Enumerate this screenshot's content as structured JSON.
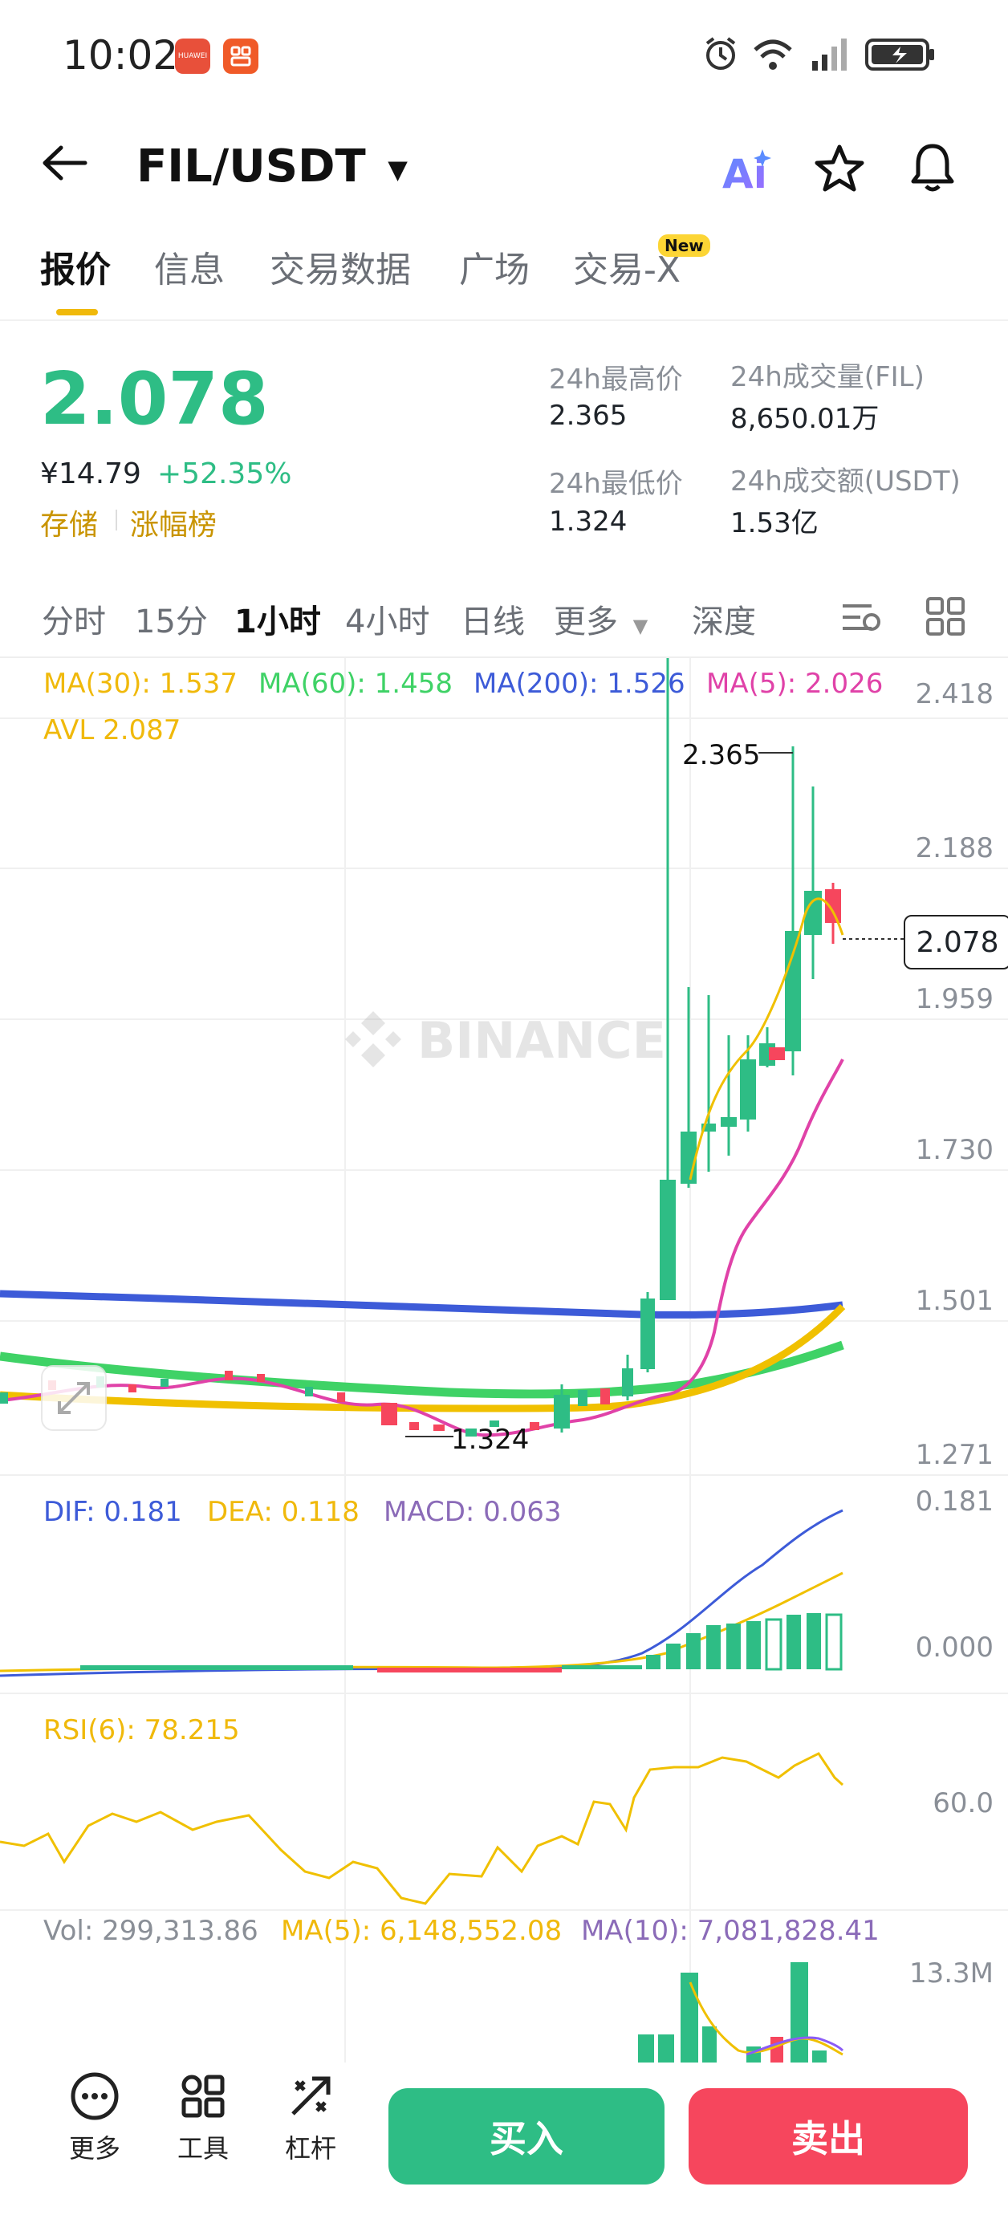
{
  "status_bar": {
    "time": "10:02",
    "app_badge_1": "HUAWEI"
  },
  "header": {
    "pair": "FIL/USDT",
    "ai_label": "Ai"
  },
  "tabs": [
    {
      "label": "报价",
      "active": true
    },
    {
      "label": "信息"
    },
    {
      "label": "交易数据"
    },
    {
      "label": "广场"
    },
    {
      "label": "交易-X",
      "badge": "New"
    }
  ],
  "ticker": {
    "last_price": "2.078",
    "cny_price": "¥14.79",
    "change_pct": "+52.35%",
    "tag_1": "存储",
    "tag_2": "涨幅榜",
    "high_label": "24h最高价",
    "high_value": "2.365",
    "low_label": "24h最低价",
    "low_value": "1.324",
    "vol_base_label": "24h成交量(FIL)",
    "vol_base_value": "8,650.01万",
    "vol_quote_label": "24h成交额(USDT)",
    "vol_quote_value": "1.53亿"
  },
  "intervals": [
    "分时",
    "15分",
    "1小时",
    "4小时",
    "日线",
    "更多",
    "深度"
  ],
  "active_interval": "1小时",
  "indicators": {
    "ma30": "MA(30): 1.537",
    "ma60": "MA(60): 1.458",
    "ma200": "MA(200): 1.526",
    "ma5": "MA(5): 2.026",
    "avl": "AVL 2.087",
    "dif": "DIF: 0.181",
    "dea": "DEA: 0.118",
    "macd": "MACD: 0.063",
    "rsi": "RSI(6): 78.215",
    "vol": "Vol: 299,313.86",
    "vol_ma5": "MA(5): 6,148,552.08",
    "vol_ma10": "MA(10): 7,081,828.41"
  },
  "price_axis": [
    "2.418",
    "2.188",
    "1.959",
    "1.730",
    "1.501",
    "1.271"
  ],
  "current_price_tag": "2.078",
  "high_marker": "2.365",
  "low_marker": "1.324",
  "watermark": "BINANCE",
  "macd_axis": [
    "0.181",
    "0.000"
  ],
  "rsi_axis": [
    "60.0"
  ],
  "vol_axis": [
    "13.3M"
  ],
  "colors": {
    "up": "#2ebd85",
    "down": "#f6465d",
    "brand": "#f0b90b",
    "ma30": "#f0b90b",
    "ma60": "#3fd266",
    "ma200": "#3d5bd8",
    "ma5": "#e042a8"
  },
  "bottom": {
    "more": "更多",
    "tools": "工具",
    "leverage": "杠杆",
    "buy": "买入",
    "sell": "卖出"
  }
}
